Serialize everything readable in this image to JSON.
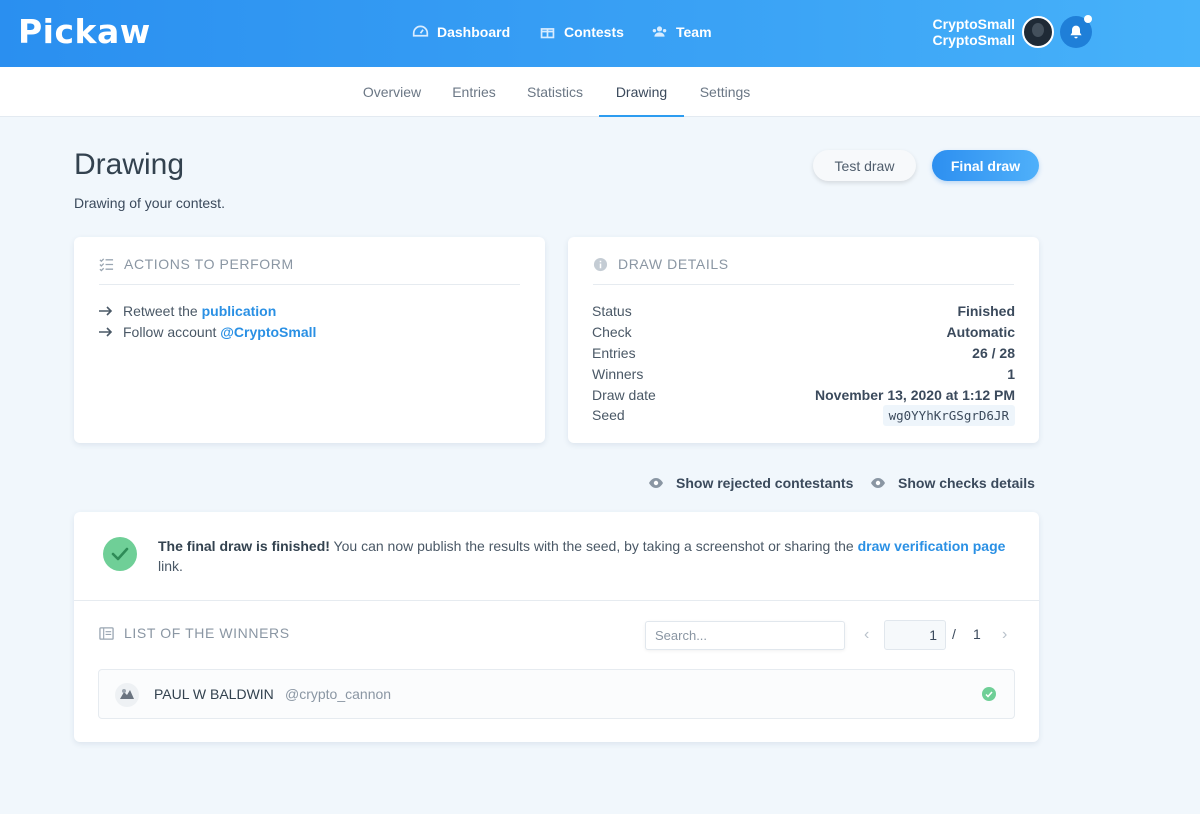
{
  "app": {
    "logo": "Pickaw"
  },
  "header": {
    "nav": [
      {
        "label": "Dashboard",
        "icon": "speedometer-icon"
      },
      {
        "label": "Contests",
        "icon": "gift-icon"
      },
      {
        "label": "Team",
        "icon": "users-icon"
      }
    ],
    "user": {
      "line1": "CryptoSmall",
      "line2": "CryptoSmall"
    }
  },
  "subnav": {
    "tabs": [
      {
        "label": "Overview",
        "active": false
      },
      {
        "label": "Entries",
        "active": false
      },
      {
        "label": "Statistics",
        "active": false
      },
      {
        "label": "Drawing",
        "active": true
      },
      {
        "label": "Settings",
        "active": false
      }
    ]
  },
  "page": {
    "title": "Drawing",
    "subtitle": "Drawing of your contest.",
    "test_draw_label": "Test draw",
    "final_draw_label": "Final draw"
  },
  "actions": {
    "heading": "ACTIONS TO PERFORM",
    "items": [
      {
        "text": "Retweet the",
        "link": "publication"
      },
      {
        "text": "Follow account",
        "link": "@CryptoSmall"
      }
    ]
  },
  "draw_details": {
    "heading": "DRAW DETAILS",
    "rows": [
      {
        "label": "Status",
        "value": "Finished"
      },
      {
        "label": "Check",
        "value": "Automatic"
      },
      {
        "label": "Entries",
        "value": "26 / 28"
      },
      {
        "label": "Winners",
        "value": "1"
      },
      {
        "label": "Draw date",
        "value": "November 13, 2020 at 1:12 PM"
      },
      {
        "label": "Seed",
        "value": "wg0YYhKrGSgrD6JR"
      }
    ]
  },
  "toggles": {
    "rejected_label": "Show rejected contestants",
    "checks_label": "Show checks details"
  },
  "result": {
    "bold": "The final draw is finished!",
    "text": " You can now publish the results with the seed, by taking a screenshot or sharing the ",
    "link": "draw verification page",
    "tail": " link."
  },
  "winners": {
    "heading": "LIST OF THE WINNERS",
    "search_placeholder": "Search...",
    "page_current": "1",
    "page_separator": "/",
    "page_total": "1",
    "list": [
      {
        "name": "PAUL W BALDWIN",
        "handle": "@crypto_cannon"
      }
    ]
  },
  "colors": {
    "header_gradient_start": "#2a8ff0",
    "header_gradient_end": "#47b2fa",
    "accent": "#2a90e4",
    "success": "#6fcf97",
    "background": "#f1f7fc"
  }
}
